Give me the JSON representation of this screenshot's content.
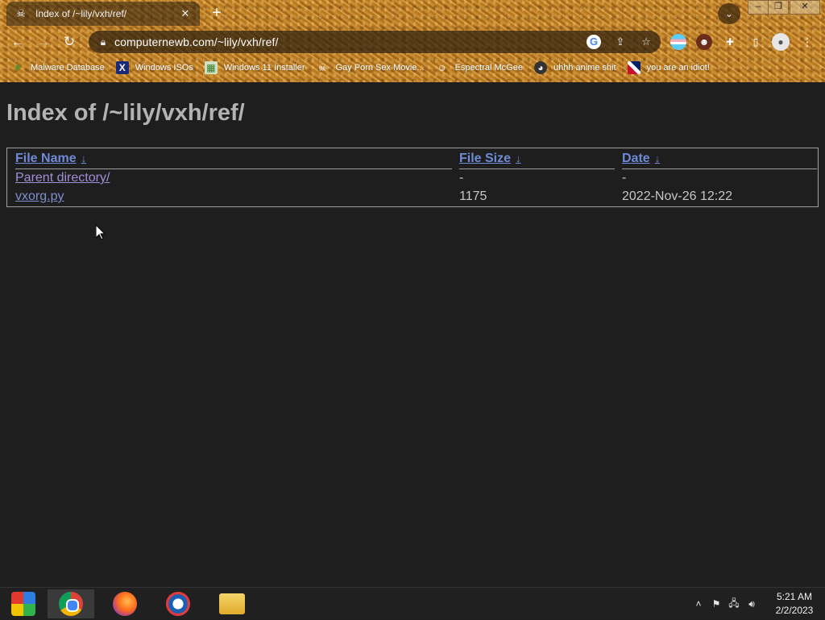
{
  "browser": {
    "tab": {
      "title": "Index of /~lily/vxh/ref/",
      "favicon": "skull-icon",
      "close": "✕"
    },
    "new_tab": "+",
    "address": {
      "url": "computernewb.com/~lily/vxh/ref/"
    },
    "bookmarks": [
      {
        "label": "Malware Database",
        "icon": "virus-icon"
      },
      {
        "label": "Windows ISOs",
        "icon": "x-logo-icon"
      },
      {
        "label": "Windows 11 Installer",
        "icon": "image-icon"
      },
      {
        "label": "Gay Porn Sex Movie...",
        "icon": "skull-icon"
      },
      {
        "label": "Espectral McGee",
        "icon": "face-icon"
      },
      {
        "label": "uhhh anime shit",
        "icon": "anime-icon"
      },
      {
        "label": "you are an idiot!",
        "icon": "flag-icon"
      }
    ]
  },
  "page": {
    "heading": "Index of /~lily/vxh/ref/",
    "columns": {
      "name": "File Name",
      "size": "File Size",
      "date": "Date",
      "sort_indicator": "↓"
    },
    "rows": [
      {
        "name": "Parent directory/",
        "size": "-",
        "date": "-"
      },
      {
        "name": "vxorg.py",
        "size": "1175",
        "date": "2022-Nov-26 12:22"
      }
    ]
  },
  "taskbar": {
    "clock_time": "5:21 AM",
    "clock_date": "2/2/2023"
  },
  "colors": {
    "page_bg": "#1e1e1e",
    "link": "#7e8fcf",
    "visited_link": "#a18fd8",
    "heading": "#b3b3b3"
  }
}
